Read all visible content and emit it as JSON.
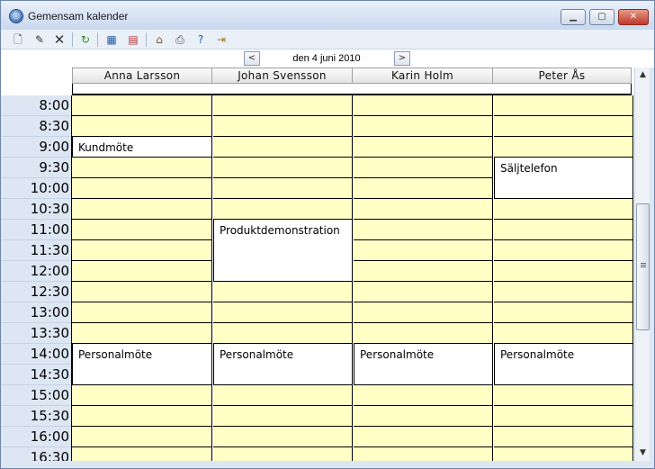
{
  "window": {
    "title": "Gemensam kalender"
  },
  "title_buttons": [
    {
      "name": "minimize-button",
      "icon": "minimize-icon"
    },
    {
      "name": "maximize-button",
      "icon": "maximize-icon"
    },
    {
      "name": "close-button",
      "icon": "close-icon"
    }
  ],
  "toolbar": [
    {
      "name": "new-button",
      "icon": "new-document-icon"
    },
    {
      "name": "edit-button",
      "icon": "edit-icon"
    },
    {
      "name": "delete-button",
      "icon": "delete-icon"
    },
    {
      "name": "refresh-button",
      "icon": "refresh-icon"
    },
    {
      "name": "calendar-view-button",
      "icon": "calendar-grid-icon"
    },
    {
      "name": "calendar-alt-button",
      "icon": "calendar-alt-icon"
    },
    {
      "name": "properties-button",
      "icon": "properties-icon"
    },
    {
      "name": "print-button",
      "icon": "printer-icon"
    },
    {
      "name": "help-button",
      "icon": "help-icon"
    },
    {
      "name": "exit-button",
      "icon": "exit-icon"
    }
  ],
  "date_nav": {
    "date": "den 4 juni 2010",
    "prev": "<",
    "next": ">"
  },
  "people": [
    "Anna  Larsson",
    "Johan  Svensson",
    "Karin  Holm",
    "Peter  Ås"
  ],
  "times": [
    "8:00",
    "8:30",
    "9:00",
    "9:30",
    "10:00",
    "10:30",
    "11:00",
    "11:30",
    "12:00",
    "12:30",
    "13:00",
    "13:30",
    "14:00",
    "14:30",
    "15:00",
    "15:30",
    "16:00",
    "16:30"
  ],
  "events": [
    {
      "person": 0,
      "start": "9:00",
      "slots": 1,
      "label": "Kundmöte"
    },
    {
      "person": 3,
      "start": "9:30",
      "slots": 2,
      "label": "Säljtelefon"
    },
    {
      "person": 1,
      "start": "11:00",
      "slots": 3,
      "label": "Produktdemonstration"
    },
    {
      "person": 0,
      "start": "14:00",
      "slots": 2,
      "label": "Personalmöte"
    },
    {
      "person": 1,
      "start": "14:00",
      "slots": 2,
      "label": "Personalmöte"
    },
    {
      "person": 2,
      "start": "14:00",
      "slots": 2,
      "label": "Personalmöte"
    },
    {
      "person": 3,
      "start": "14:00",
      "slots": 2,
      "label": "Personalmöte"
    }
  ],
  "colors": {
    "free_slot": "#ffffc6",
    "event": "#ffffff",
    "time_column": "#dde6f3"
  }
}
